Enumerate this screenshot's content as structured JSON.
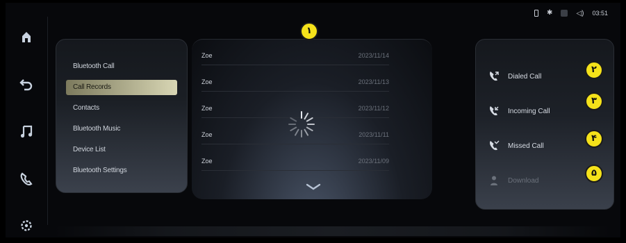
{
  "status_bar": {
    "time": "03:51"
  },
  "dock": {
    "items": [
      {
        "icon": "home-icon"
      },
      {
        "icon": "back-icon"
      },
      {
        "icon": "music-icon"
      },
      {
        "icon": "phone-icon"
      },
      {
        "icon": "settings-icon"
      }
    ]
  },
  "menu": {
    "items": [
      {
        "label": "Bluetooth Call"
      },
      {
        "label": "Call Records",
        "active": true
      },
      {
        "label": "Contacts"
      },
      {
        "label": "Bluetooth Music"
      },
      {
        "label": "Device List"
      },
      {
        "label": "Bluetooth Settings"
      }
    ]
  },
  "records": [
    {
      "name": "Zoe",
      "date": "2023/11/14"
    },
    {
      "name": "Zoe",
      "date": "2023/11/13"
    },
    {
      "name": "Zoe",
      "date": "2023/11/12"
    },
    {
      "name": "Zoe",
      "date": "2023/11/11"
    },
    {
      "name": "Zoe",
      "date": "2023/11/09"
    }
  ],
  "call_types": [
    {
      "label": "Dialed Call",
      "icon": "dialed-call-icon"
    },
    {
      "label": "Incoming Call",
      "icon": "incoming-call-icon"
    },
    {
      "label": "Missed Call",
      "icon": "missed-call-icon"
    },
    {
      "label": "Download",
      "icon": "download-icon",
      "disabled": true
    }
  ],
  "badges": [
    "١",
    "٢",
    "٣",
    "۴",
    "۵"
  ],
  "colors": {
    "accent_active": "#d8d6b4",
    "badge": "#f5e21a",
    "background": "#07080b"
  }
}
